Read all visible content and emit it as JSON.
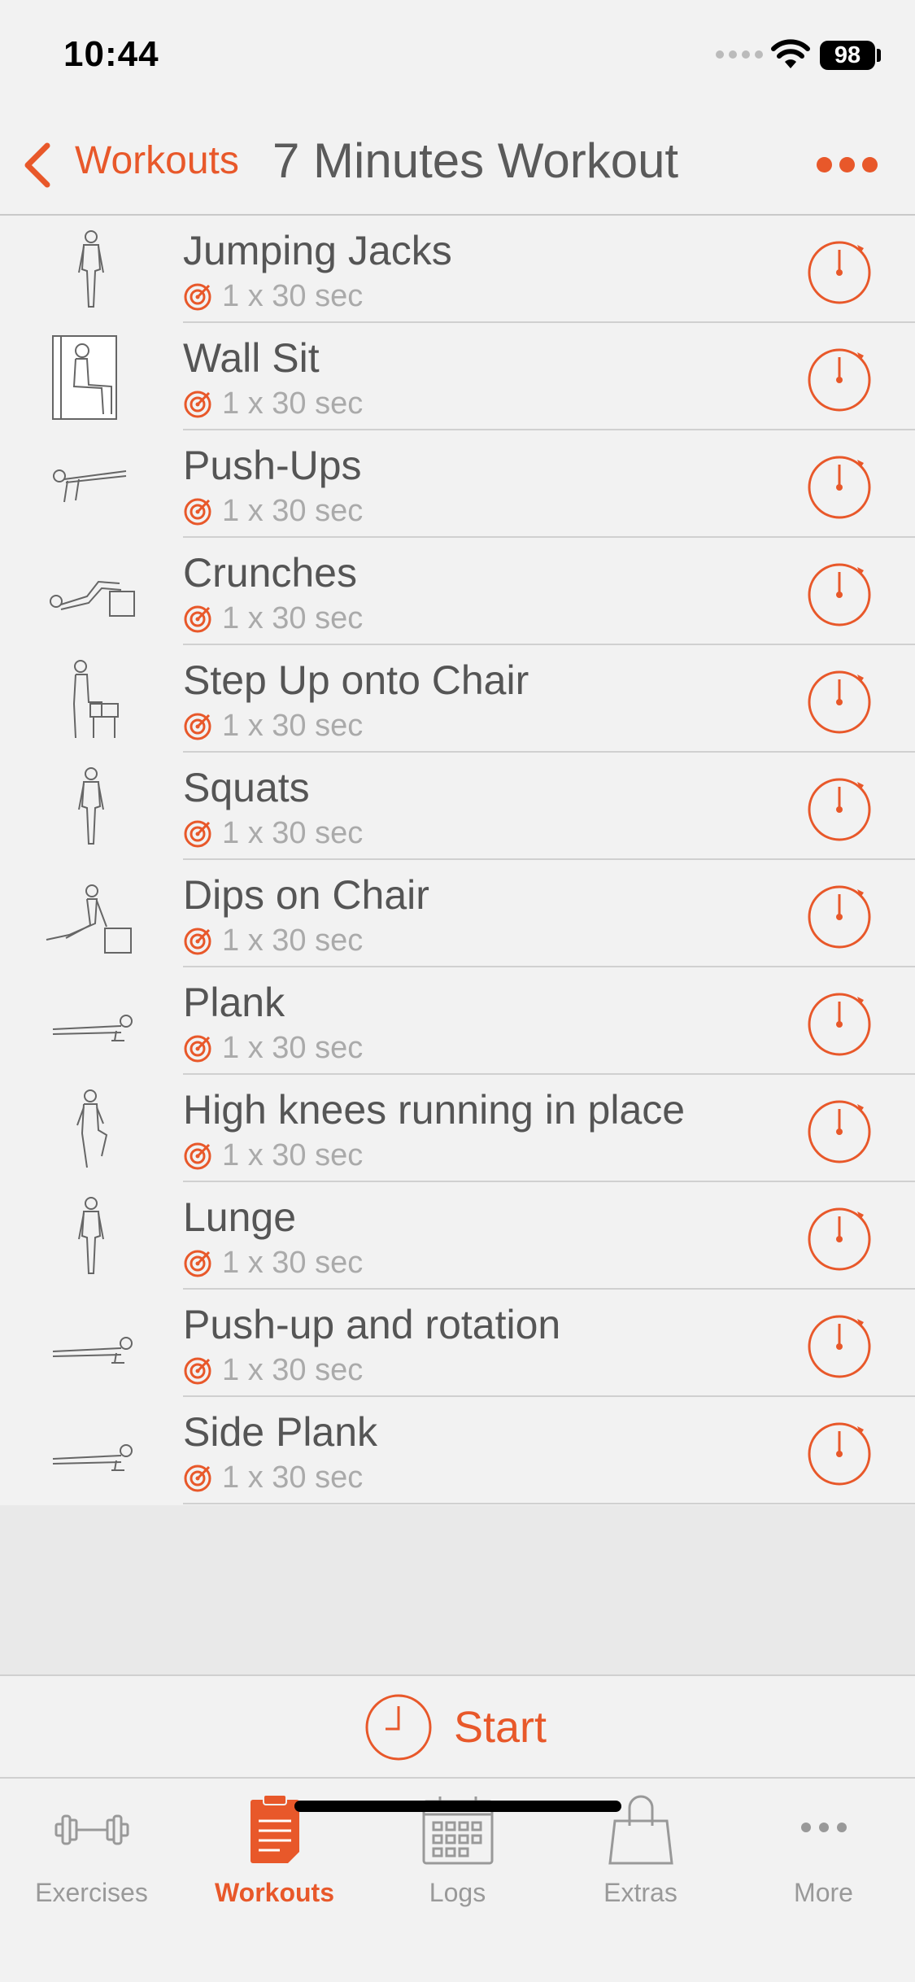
{
  "status_bar": {
    "time": "10:44",
    "battery": "98"
  },
  "nav": {
    "back_label": "Workouts",
    "title": "7 Minutes Workout"
  },
  "exercises": [
    {
      "name": "Jumping Jacks",
      "detail": "1 x 30 sec",
      "figure": "standing-figure"
    },
    {
      "name": "Wall Sit",
      "detail": "1 x 30 sec",
      "figure": "wall-sit-figure"
    },
    {
      "name": "Push-Ups",
      "detail": "1 x 30 sec",
      "figure": "push-up-figure"
    },
    {
      "name": "Crunches",
      "detail": "1 x 30 sec",
      "figure": "crunch-figure"
    },
    {
      "name": "Step Up onto Chair",
      "detail": "1 x 30 sec",
      "figure": "step-up-figure"
    },
    {
      "name": "Squats",
      "detail": "1 x 30 sec",
      "figure": "standing-figure"
    },
    {
      "name": "Dips on Chair",
      "detail": "1 x 30 sec",
      "figure": "dips-figure"
    },
    {
      "name": "Plank",
      "detail": "1 x 30 sec",
      "figure": "plank-figure"
    },
    {
      "name": "High knees running in place",
      "detail": "1 x 30 sec",
      "figure": "high-knees-figure"
    },
    {
      "name": "Lunge",
      "detail": "1 x 30 sec",
      "figure": "standing-figure"
    },
    {
      "name": "Push-up and rotation",
      "detail": "1 x 30 sec",
      "figure": "plank-figure"
    },
    {
      "name": "Side Plank",
      "detail": "1 x 30 sec",
      "figure": "plank-figure"
    }
  ],
  "start": {
    "label": "Start"
  },
  "tabs": [
    {
      "label": "Exercises",
      "icon": "dumbbell-icon",
      "active": false
    },
    {
      "label": "Workouts",
      "icon": "clipboard-icon",
      "active": true
    },
    {
      "label": "Logs",
      "icon": "calendar-icon",
      "active": false
    },
    {
      "label": "Extras",
      "icon": "shopping-bag-icon",
      "active": false
    },
    {
      "label": "More",
      "icon": "more-dots-icon",
      "active": false
    }
  ],
  "colors": {
    "accent": "#e8582a",
    "text": "#555555",
    "muted": "#aaaaaa",
    "background": "#f2f2f2"
  }
}
